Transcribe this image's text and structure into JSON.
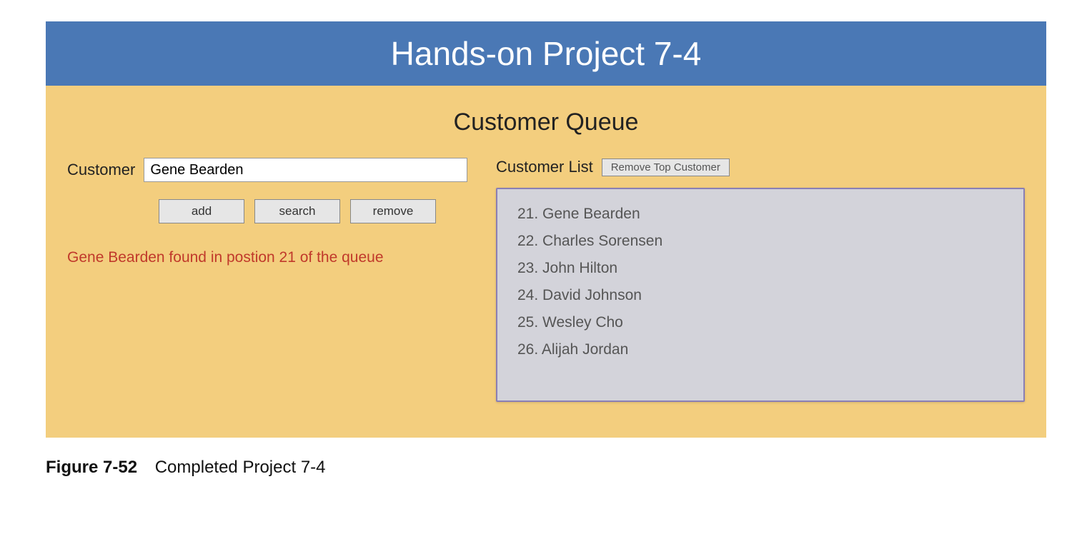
{
  "header": {
    "title": "Hands-on Project 7-4"
  },
  "main": {
    "subtitle": "Customer Queue",
    "customerForm": {
      "label": "Customer",
      "inputValue": "Gene Bearden",
      "buttons": {
        "add": "add",
        "search": "search",
        "remove": "remove"
      },
      "statusMessage": "Gene Bearden found in postion 21 of the queue"
    },
    "customerList": {
      "title": "Customer List",
      "removeTopLabel": "Remove Top Customer",
      "startIndex": 21,
      "items": [
        "Gene Bearden",
        "Charles Sorensen",
        "John Hilton",
        "David Johnson",
        "Wesley Cho",
        "Alijah Jordan"
      ]
    }
  },
  "figure": {
    "label": "Figure 7-52",
    "caption": "Completed Project 7-4"
  }
}
